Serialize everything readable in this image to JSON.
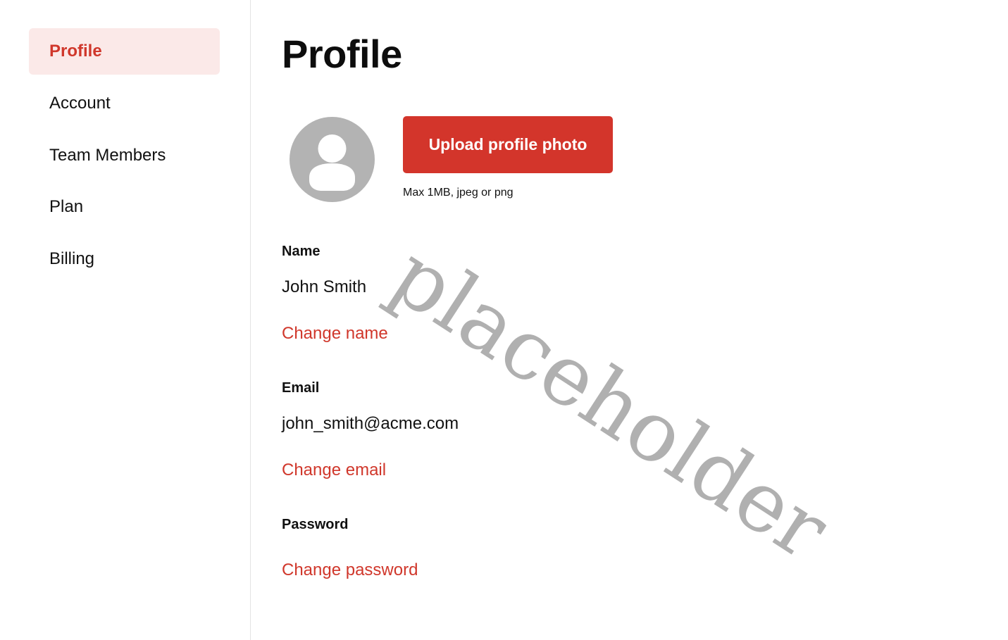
{
  "sidebar": {
    "items": [
      {
        "label": "Profile",
        "active": true
      },
      {
        "label": "Account",
        "active": false
      },
      {
        "label": "Team Members",
        "active": false
      },
      {
        "label": "Plan",
        "active": false
      },
      {
        "label": "Billing",
        "active": false
      }
    ]
  },
  "main": {
    "title": "Profile",
    "avatar_icon": "user-circle-icon",
    "upload_button_label": "Upload profile photo",
    "upload_hint": "Max 1MB, jpeg or png",
    "name": {
      "label": "Name",
      "value": "John Smith",
      "action": "Change name"
    },
    "email": {
      "label": "Email",
      "value": "john_smith@acme.com",
      "action": "Change email"
    },
    "password": {
      "label": "Password",
      "action": "Change password"
    }
  },
  "watermark": "placeholder",
  "colors": {
    "accent": "#d3352b",
    "active_bg": "#fbe9e8",
    "avatar": "#b3b3b3"
  }
}
